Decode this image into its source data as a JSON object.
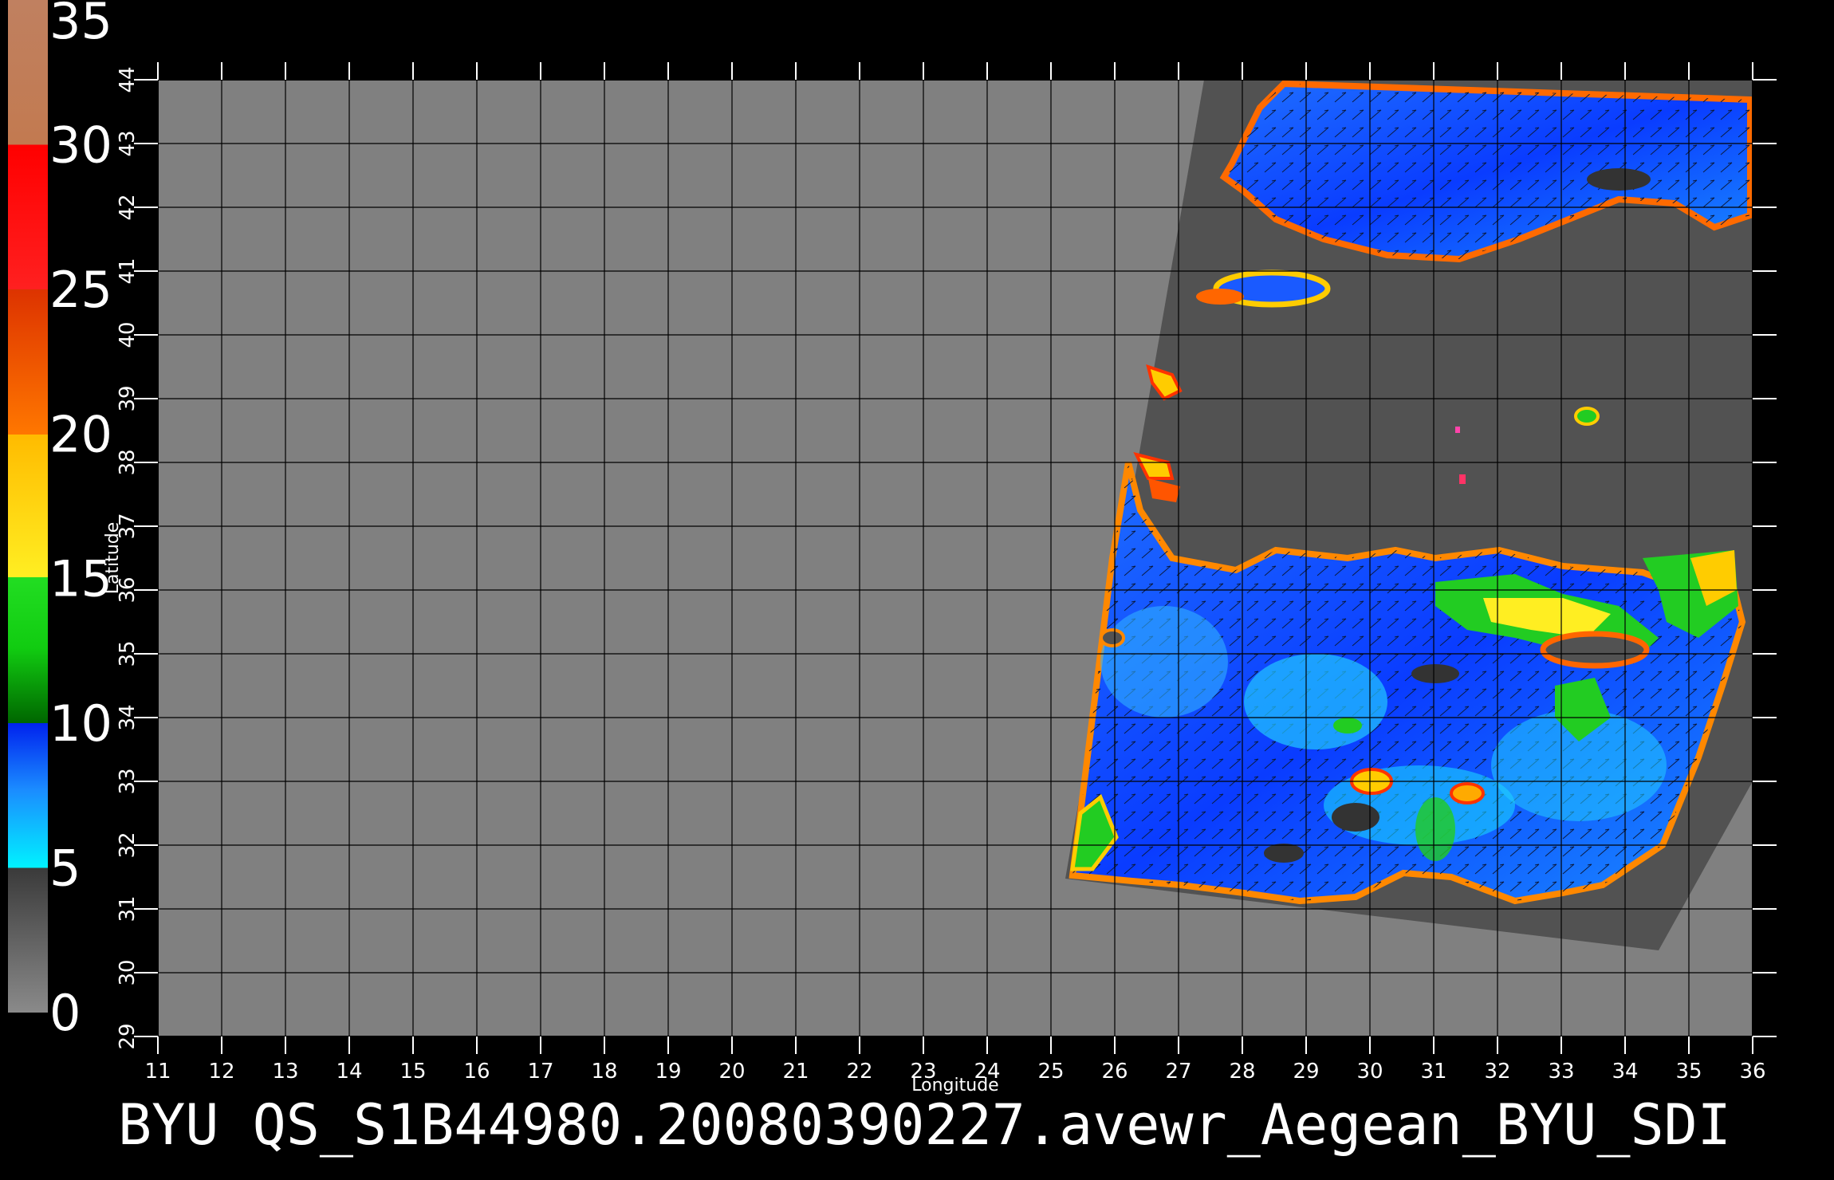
{
  "caption": "BYU QS_S1B44980.20080390227.avewr_Aegean_BYU_SDI",
  "map": {
    "lon_range": [
      11,
      36
    ],
    "lat_range": [
      29,
      44
    ],
    "xlabel": "Longitude",
    "ylabel": "Latitude",
    "lon_ticks": [
      "11",
      "12",
      "13",
      "14",
      "15",
      "16",
      "17",
      "18",
      "19",
      "20",
      "21",
      "22",
      "23",
      "24",
      "25",
      "26",
      "27",
      "28",
      "29",
      "30",
      "31",
      "32",
      "33",
      "34",
      "35",
      "36"
    ],
    "lat_ticks": [
      "29",
      "30",
      "31",
      "32",
      "33",
      "34",
      "35",
      "36",
      "37",
      "38",
      "39",
      "40",
      "41",
      "42",
      "43",
      "44"
    ],
    "grid": true,
    "background_color": "#808080",
    "swath_color": "#505050"
  },
  "color_scale": {
    "labels": [
      "0",
      "5",
      "10",
      "15",
      "20",
      "25",
      "30",
      "35"
    ],
    "range": [
      0,
      35
    ]
  }
}
